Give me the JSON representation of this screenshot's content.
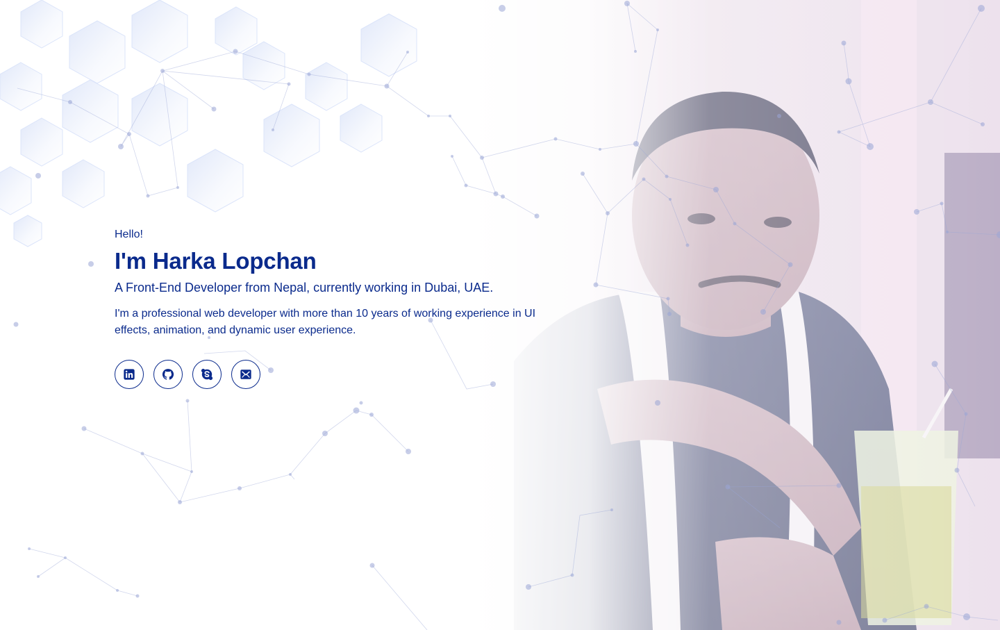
{
  "hero": {
    "greeting": "Hello!",
    "name": "I'm Harka Lopchan",
    "tagline": "A Front-End Developer from Nepal, currently working in Dubai, UAE.",
    "bio": "I'm a professional web developer with more than 10 years of working experience in UI effects, animation, and dynamic user experience."
  },
  "socials": [
    {
      "name": "linkedin",
      "icon": "linkedin-icon"
    },
    {
      "name": "github",
      "icon": "github-icon"
    },
    {
      "name": "skype",
      "icon": "skype-icon"
    },
    {
      "name": "email",
      "icon": "email-icon"
    }
  ],
  "colors": {
    "primary": "#0a2a8c",
    "network_line": "#9aa6d6",
    "hexagon": "#c9d6f5",
    "background": "#ffffff"
  }
}
